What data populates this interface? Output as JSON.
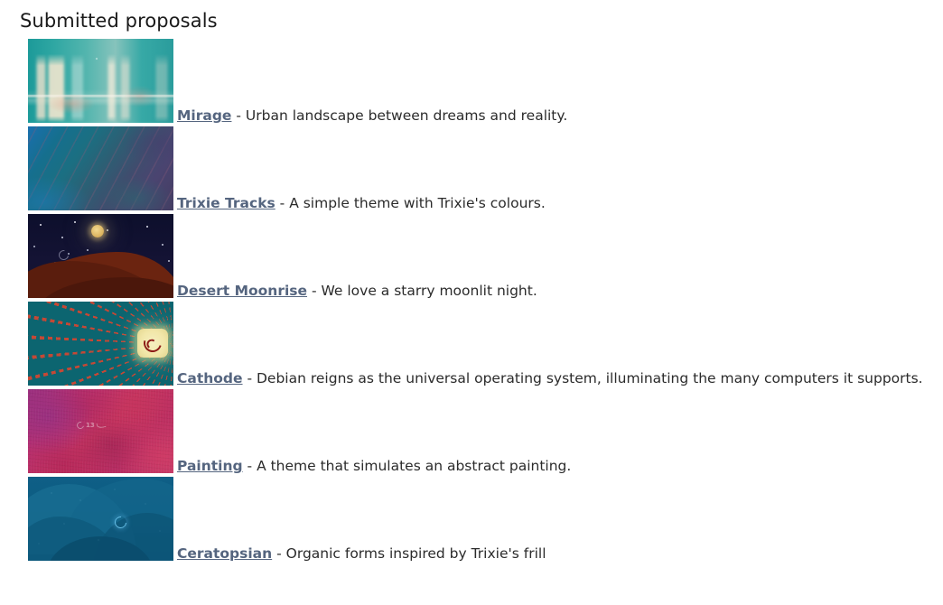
{
  "page": {
    "title": "Submitted proposals",
    "background_color": "#ffffff",
    "link_color": "#55657f",
    "text_color": "#2b2b2b"
  },
  "proposals": [
    {
      "name": "Mirage",
      "separator": " - ",
      "description": "Urban landscape between dreams and reality.",
      "thumbnail_alt": "Teal urban abstraction with pale cream building blocks",
      "thumbnail_colors": [
        "#1c9a99",
        "#53b5ae",
        "#f6e7d0",
        "#e89682"
      ]
    },
    {
      "name": "Trixie Tracks",
      "separator": " - ",
      "description": "A simple theme with Trixie's colours.",
      "thumbnail_alt": "Diagonal striped gradient from blue to purple",
      "thumbnail_colors": [
        "#1b6fae",
        "#2c5f74",
        "#443d63",
        "#8c5a78"
      ]
    },
    {
      "name": "Desert Moonrise",
      "separator": " - ",
      "description": "We love a starry moonlit night.",
      "thumbnail_alt": "Starry night sky with glowing moon over dark red dunes",
      "thumbnail_colors": [
        "#0d0f2c",
        "#6b2410",
        "#dcb562",
        "#e6e6f0"
      ]
    },
    {
      "name": "Cathode",
      "separator": " - ",
      "description": "Debian reigns as the universal operating system, illuminating the many computers it supports.",
      "thumbnail_alt": "Teal field with red dashed rays radiating from a glowing Debian swirl",
      "thumbnail_colors": [
        "#0c6570",
        "#d64530",
        "#f1e6a8",
        "#8d1b17"
      ]
    },
    {
      "name": "Painting",
      "separator": " - ",
      "description": "A theme that simulates an abstract painting.",
      "thumbnail_alt": "Abstract pink and magenta painted wash with faint Debian 13 mark",
      "thumbnail_colors": [
        "#9b2f7e",
        "#c5335f",
        "#b72f70",
        "#d63c64"
      ],
      "thumbnail_mark": "13"
    },
    {
      "name": "Ceratopsian",
      "separator": " - ",
      "description": "Organic forms inspired by Trixie's frill",
      "thumbnail_alt": "Layered organic blue frill forms with a small glowing swirl",
      "thumbnail_colors": [
        "#0f5f86",
        "#1a6f93",
        "#0a4c6d",
        "#6ec8f0"
      ]
    }
  ]
}
